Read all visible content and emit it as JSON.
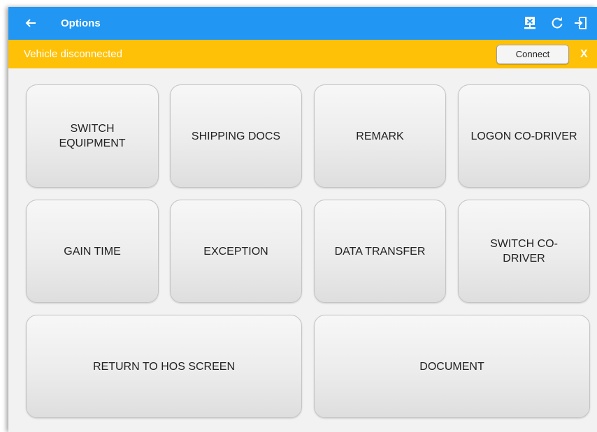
{
  "appbar": {
    "title": "Options",
    "icons": [
      "back-arrow",
      "disconnected-device",
      "refresh",
      "logout"
    ]
  },
  "banner": {
    "message": "Vehicle disconnected",
    "connect_label": "Connect",
    "close_label": "X"
  },
  "buttons": {
    "switch_equipment": "SWITCH EQUIPMENT",
    "shipping_docs": "SHIPPING DOCS",
    "remark": "REMARK",
    "logon_co_driver": "LOGON CO-DRIVER",
    "gain_time": "GAIN TIME",
    "exception": "EXCEPTION",
    "data_transfer": "DATA TRANSFER",
    "switch_co_driver": "SWITCH CO-DRIVER",
    "return_to_hos": "RETURN TO HOS SCREEN",
    "document": "DOCUMENT"
  },
  "colors": {
    "appbar": "#2196f3",
    "banner": "#ffc107",
    "background": "#f2f2f2"
  }
}
